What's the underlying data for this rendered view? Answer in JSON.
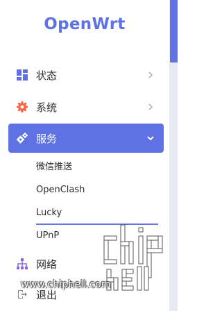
{
  "logo": {
    "text": "OpenWrt"
  },
  "nav": {
    "status": {
      "label": "状态",
      "icon": "dashboard-icon"
    },
    "system": {
      "label": "系统",
      "icon": "gear-icon"
    },
    "services": {
      "label": "服务",
      "icon": "cogs-icon"
    },
    "network": {
      "label": "网络",
      "icon": "sitemap-icon"
    },
    "logout": {
      "label": "退出",
      "icon": "logout-icon"
    }
  },
  "submenu": {
    "items": [
      "微信推送",
      "OpenClash",
      "Lucky",
      "UPnP"
    ],
    "selected": "Lucky"
  },
  "watermark": {
    "text": "www.chiphell.com"
  },
  "colors": {
    "accent": "#5e72e4",
    "icon_orange": "#fb6340",
    "text": "#2d2d2d"
  }
}
